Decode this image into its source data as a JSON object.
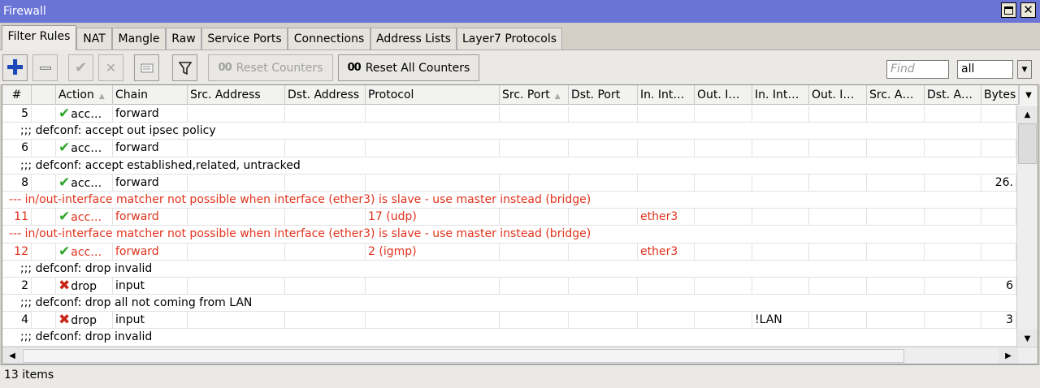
{
  "window": {
    "title": "Firewall"
  },
  "tabs": [
    {
      "label": "Filter Rules"
    },
    {
      "label": "NAT"
    },
    {
      "label": "Mangle"
    },
    {
      "label": "Raw"
    },
    {
      "label": "Service Ports"
    },
    {
      "label": "Connections"
    },
    {
      "label": "Address Lists"
    },
    {
      "label": "Layer7 Protocols"
    }
  ],
  "toolbar": {
    "reset_counters_label": "Reset Counters",
    "reset_all_counters_label": "Reset All Counters",
    "counter_prefix": "00",
    "find_placeholder": "Find",
    "filter_value": "all"
  },
  "columns": [
    "#",
    "",
    "Action",
    "Chain",
    "Src. Address",
    "Dst. Address",
    "Protocol",
    "Src. Port",
    "Dst. Port",
    "In. Int…",
    "Out. I…",
    "In. Int…",
    "Out. I…",
    "Src. A…",
    "Dst. A…",
    "Bytes"
  ],
  "rows": [
    {
      "type": "rule",
      "num": "5",
      "action": "acc…",
      "icon": "check",
      "chain": "forward",
      "protocol": "",
      "in_iface": "",
      "in_list": "",
      "bytes": "",
      "red": false
    },
    {
      "type": "comment",
      "text": ";;; defconf: accept out ipsec policy"
    },
    {
      "type": "rule",
      "num": "6",
      "action": "acc…",
      "icon": "check",
      "chain": "forward",
      "protocol": "",
      "in_iface": "",
      "in_list": "",
      "bytes": "",
      "red": false
    },
    {
      "type": "comment",
      "text": ";;; defconf: accept established,related, untracked"
    },
    {
      "type": "rule",
      "num": "8",
      "action": "acc…",
      "icon": "check",
      "chain": "forward",
      "protocol": "",
      "in_iface": "",
      "in_list": "",
      "bytes": "26.",
      "red": false
    },
    {
      "type": "warn",
      "text": "--- in/out-interface matcher not possible when interface (ether3) is slave - use master instead (bridge)"
    },
    {
      "type": "rule",
      "num": "11",
      "action": "acc…",
      "icon": "check",
      "chain": "forward",
      "protocol": "17 (udp)",
      "in_iface": "ether3",
      "in_list": "",
      "bytes": "",
      "red": true
    },
    {
      "type": "warn",
      "text": "--- in/out-interface matcher not possible when interface (ether3) is slave - use master instead (bridge)"
    },
    {
      "type": "rule",
      "num": "12",
      "action": "acc…",
      "icon": "check",
      "chain": "forward",
      "protocol": "2 (igmp)",
      "in_iface": "ether3",
      "in_list": "",
      "bytes": "",
      "red": true
    },
    {
      "type": "comment",
      "text": ";;; defconf: drop invalid"
    },
    {
      "type": "rule",
      "num": "2",
      "action": "drop",
      "icon": "x",
      "chain": "input",
      "protocol": "",
      "in_iface": "",
      "in_list": "",
      "bytes": "6",
      "red": false
    },
    {
      "type": "comment",
      "text": ";;; defconf: drop all not coming from LAN"
    },
    {
      "type": "rule",
      "num": "4",
      "action": "drop",
      "icon": "x",
      "chain": "input",
      "protocol": "",
      "in_iface": "",
      "in_list": "!LAN",
      "bytes": "3",
      "red": false
    },
    {
      "type": "comment",
      "text": ";;; defconf: drop invalid"
    }
  ],
  "status": {
    "item_count": "13 items"
  },
  "colors": {
    "titlebar": "#6a74d6",
    "warning_red": "#e0331c",
    "accept_green": "#2fa52a",
    "drop_red": "#c8261a",
    "add_blue": "#1c48b8"
  }
}
